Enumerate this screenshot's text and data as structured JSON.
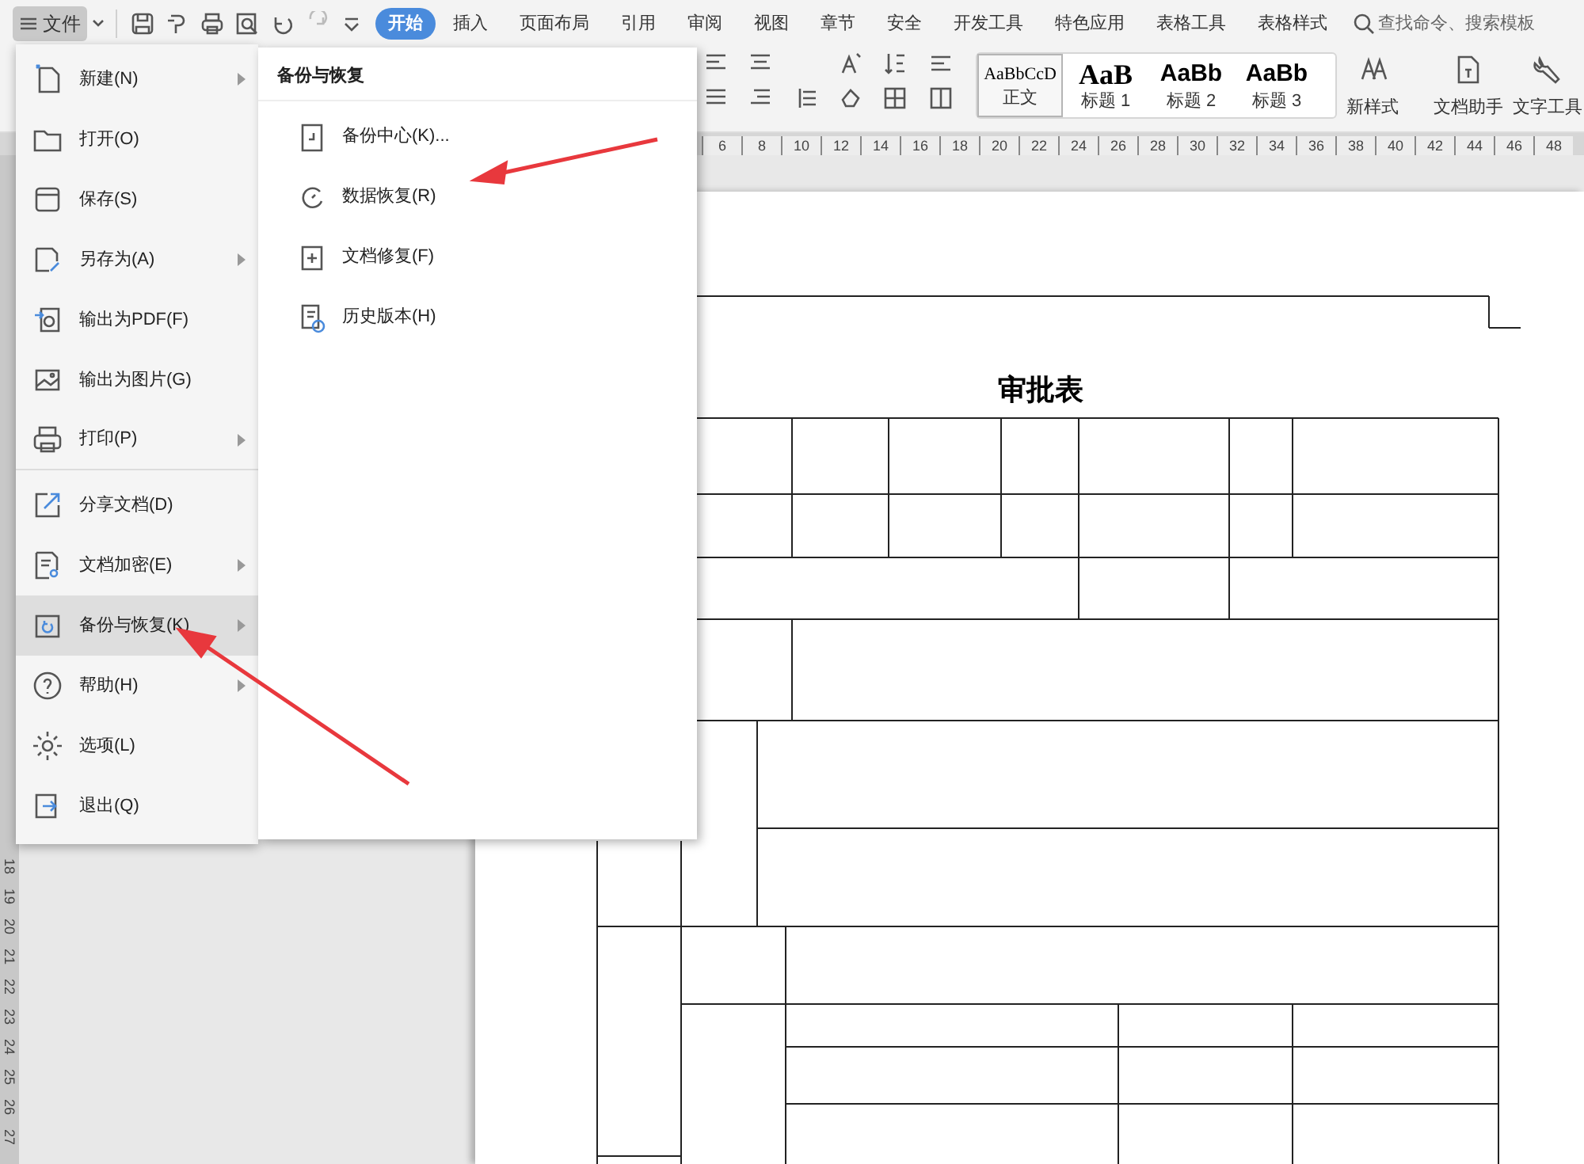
{
  "toolbar": {
    "file_button": "文件",
    "tabs": [
      {
        "label": "开始",
        "selected": true
      },
      {
        "label": "插入",
        "selected": false
      },
      {
        "label": "页面布局",
        "selected": false
      },
      {
        "label": "引用",
        "selected": false
      },
      {
        "label": "审阅",
        "selected": false
      },
      {
        "label": "视图",
        "selected": false
      },
      {
        "label": "章节",
        "selected": false
      },
      {
        "label": "安全",
        "selected": false
      },
      {
        "label": "开发工具",
        "selected": false
      },
      {
        "label": "特色应用",
        "selected": false
      },
      {
        "label": "表格工具",
        "selected": false
      },
      {
        "label": "表格样式",
        "selected": false
      }
    ],
    "search": {
      "placeholder": "查找命令、搜索模板"
    }
  },
  "ribbon": {
    "styles": [
      {
        "preview": "AaBbCcD",
        "label": "正文",
        "selected": true
      },
      {
        "preview": "AaB",
        "label": "标题 1",
        "selected": false
      },
      {
        "preview": "AaBb",
        "label": "标题 2",
        "selected": false
      },
      {
        "preview": "AaBb",
        "label": "标题 3",
        "selected": false
      }
    ],
    "buttons": [
      "新样式",
      "文档助手",
      "文字工具"
    ]
  },
  "ruler": {
    "horizontal": [
      "6",
      "8",
      "10",
      "12",
      "14",
      "16",
      "18",
      "20",
      "22",
      "24",
      "26",
      "28",
      "30",
      "32",
      "34",
      "36",
      "38",
      "40",
      "42",
      "44",
      "46",
      "48"
    ],
    "vertical": [
      "18",
      "19",
      "20",
      "21",
      "22",
      "23",
      "24",
      "25",
      "26",
      "27"
    ]
  },
  "file_menu": {
    "items": [
      {
        "label": "新建(N)",
        "has_submenu": true,
        "selected": false,
        "divider_after": false
      },
      {
        "label": "打开(O)",
        "has_submenu": false,
        "selected": false,
        "divider_after": false
      },
      {
        "label": "保存(S)",
        "has_submenu": false,
        "selected": false,
        "divider_after": false
      },
      {
        "label": "另存为(A)",
        "has_submenu": true,
        "selected": false,
        "divider_after": false
      },
      {
        "label": "输出为PDF(F)",
        "has_submenu": false,
        "selected": false,
        "divider_after": false
      },
      {
        "label": "输出为图片(G)",
        "has_submenu": false,
        "selected": false,
        "divider_after": false
      },
      {
        "label": "打印(P)",
        "has_submenu": true,
        "selected": false,
        "divider_after": true
      },
      {
        "label": "分享文档(D)",
        "has_submenu": false,
        "selected": false,
        "divider_after": false
      },
      {
        "label": "文档加密(E)",
        "has_submenu": true,
        "selected": false,
        "divider_after": false
      },
      {
        "label": "备份与恢复(K)",
        "has_submenu": true,
        "selected": true,
        "divider_after": false
      },
      {
        "label": "帮助(H)",
        "has_submenu": true,
        "selected": false,
        "divider_after": false
      },
      {
        "label": "选项(L)",
        "has_submenu": false,
        "selected": false,
        "divider_after": false
      },
      {
        "label": "退出(Q)",
        "has_submenu": false,
        "selected": false,
        "divider_after": false
      }
    ]
  },
  "submenu": {
    "title": "备份与恢复",
    "items": [
      "备份中心(K)...",
      "数据恢复(R)",
      "文档修复(F)",
      "历史版本(H)"
    ]
  },
  "document": {
    "title": "审批表"
  }
}
